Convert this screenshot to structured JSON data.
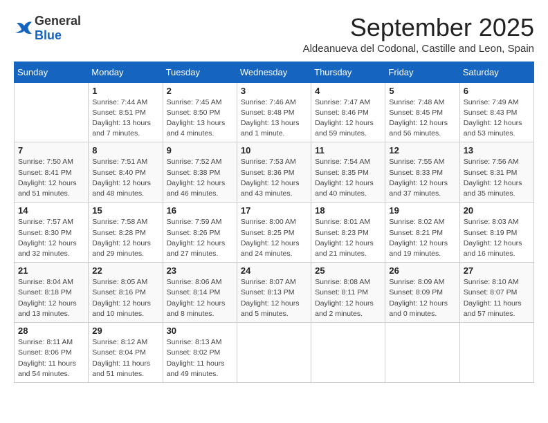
{
  "header": {
    "logo_general": "General",
    "logo_blue": "Blue",
    "title": "September 2025",
    "subtitle": "Aldeanueva del Codonal, Castille and Leon, Spain"
  },
  "days_of_week": [
    "Sunday",
    "Monday",
    "Tuesday",
    "Wednesday",
    "Thursday",
    "Friday",
    "Saturday"
  ],
  "weeks": [
    [
      {
        "day": "",
        "detail": ""
      },
      {
        "day": "1",
        "detail": "Sunrise: 7:44 AM\nSunset: 8:51 PM\nDaylight: 13 hours\nand 7 minutes."
      },
      {
        "day": "2",
        "detail": "Sunrise: 7:45 AM\nSunset: 8:50 PM\nDaylight: 13 hours\nand 4 minutes."
      },
      {
        "day": "3",
        "detail": "Sunrise: 7:46 AM\nSunset: 8:48 PM\nDaylight: 13 hours\nand 1 minute."
      },
      {
        "day": "4",
        "detail": "Sunrise: 7:47 AM\nSunset: 8:46 PM\nDaylight: 12 hours\nand 59 minutes."
      },
      {
        "day": "5",
        "detail": "Sunrise: 7:48 AM\nSunset: 8:45 PM\nDaylight: 12 hours\nand 56 minutes."
      },
      {
        "day": "6",
        "detail": "Sunrise: 7:49 AM\nSunset: 8:43 PM\nDaylight: 12 hours\nand 53 minutes."
      }
    ],
    [
      {
        "day": "7",
        "detail": "Sunrise: 7:50 AM\nSunset: 8:41 PM\nDaylight: 12 hours\nand 51 minutes."
      },
      {
        "day": "8",
        "detail": "Sunrise: 7:51 AM\nSunset: 8:40 PM\nDaylight: 12 hours\nand 48 minutes."
      },
      {
        "day": "9",
        "detail": "Sunrise: 7:52 AM\nSunset: 8:38 PM\nDaylight: 12 hours\nand 46 minutes."
      },
      {
        "day": "10",
        "detail": "Sunrise: 7:53 AM\nSunset: 8:36 PM\nDaylight: 12 hours\nand 43 minutes."
      },
      {
        "day": "11",
        "detail": "Sunrise: 7:54 AM\nSunset: 8:35 PM\nDaylight: 12 hours\nand 40 minutes."
      },
      {
        "day": "12",
        "detail": "Sunrise: 7:55 AM\nSunset: 8:33 PM\nDaylight: 12 hours\nand 37 minutes."
      },
      {
        "day": "13",
        "detail": "Sunrise: 7:56 AM\nSunset: 8:31 PM\nDaylight: 12 hours\nand 35 minutes."
      }
    ],
    [
      {
        "day": "14",
        "detail": "Sunrise: 7:57 AM\nSunset: 8:30 PM\nDaylight: 12 hours\nand 32 minutes."
      },
      {
        "day": "15",
        "detail": "Sunrise: 7:58 AM\nSunset: 8:28 PM\nDaylight: 12 hours\nand 29 minutes."
      },
      {
        "day": "16",
        "detail": "Sunrise: 7:59 AM\nSunset: 8:26 PM\nDaylight: 12 hours\nand 27 minutes."
      },
      {
        "day": "17",
        "detail": "Sunrise: 8:00 AM\nSunset: 8:25 PM\nDaylight: 12 hours\nand 24 minutes."
      },
      {
        "day": "18",
        "detail": "Sunrise: 8:01 AM\nSunset: 8:23 PM\nDaylight: 12 hours\nand 21 minutes."
      },
      {
        "day": "19",
        "detail": "Sunrise: 8:02 AM\nSunset: 8:21 PM\nDaylight: 12 hours\nand 19 minutes."
      },
      {
        "day": "20",
        "detail": "Sunrise: 8:03 AM\nSunset: 8:19 PM\nDaylight: 12 hours\nand 16 minutes."
      }
    ],
    [
      {
        "day": "21",
        "detail": "Sunrise: 8:04 AM\nSunset: 8:18 PM\nDaylight: 12 hours\nand 13 minutes."
      },
      {
        "day": "22",
        "detail": "Sunrise: 8:05 AM\nSunset: 8:16 PM\nDaylight: 12 hours\nand 10 minutes."
      },
      {
        "day": "23",
        "detail": "Sunrise: 8:06 AM\nSunset: 8:14 PM\nDaylight: 12 hours\nand 8 minutes."
      },
      {
        "day": "24",
        "detail": "Sunrise: 8:07 AM\nSunset: 8:13 PM\nDaylight: 12 hours\nand 5 minutes."
      },
      {
        "day": "25",
        "detail": "Sunrise: 8:08 AM\nSunset: 8:11 PM\nDaylight: 12 hours\nand 2 minutes."
      },
      {
        "day": "26",
        "detail": "Sunrise: 8:09 AM\nSunset: 8:09 PM\nDaylight: 12 hours\nand 0 minutes."
      },
      {
        "day": "27",
        "detail": "Sunrise: 8:10 AM\nSunset: 8:07 PM\nDaylight: 11 hours\nand 57 minutes."
      }
    ],
    [
      {
        "day": "28",
        "detail": "Sunrise: 8:11 AM\nSunset: 8:06 PM\nDaylight: 11 hours\nand 54 minutes."
      },
      {
        "day": "29",
        "detail": "Sunrise: 8:12 AM\nSunset: 8:04 PM\nDaylight: 11 hours\nand 51 minutes."
      },
      {
        "day": "30",
        "detail": "Sunrise: 8:13 AM\nSunset: 8:02 PM\nDaylight: 11 hours\nand 49 minutes."
      },
      {
        "day": "",
        "detail": ""
      },
      {
        "day": "",
        "detail": ""
      },
      {
        "day": "",
        "detail": ""
      },
      {
        "day": "",
        "detail": ""
      }
    ]
  ]
}
